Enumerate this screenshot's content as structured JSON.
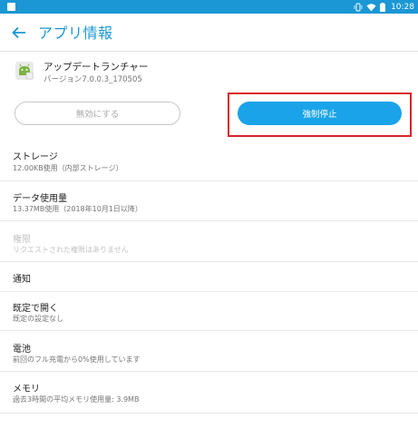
{
  "status_bar": {
    "time": "10:28",
    "icons": [
      "vibrate-icon",
      "wifi-icon",
      "battery-icon"
    ]
  },
  "app_bar": {
    "title": "アプリ情報",
    "back_icon": "arrow-left-icon"
  },
  "app": {
    "name": "アップデートランチャー",
    "version": "バージョン7.0.0.3_170505",
    "icon": "android-app-icon"
  },
  "buttons": {
    "disable": "無効にする",
    "force_stop": "強制停止"
  },
  "settings": [
    {
      "title": "ストレージ",
      "summary": "12.00KB使用（内部ストレージ）",
      "enabled": true
    },
    {
      "title": "データ使用量",
      "summary": "13.37MB使用（2018年10月1日以降）",
      "enabled": true
    },
    {
      "title": "権限",
      "summary": "リクエストされた権限はありません",
      "enabled": false
    },
    {
      "title": "通知",
      "summary": "",
      "enabled": true
    },
    {
      "title": "既定で開く",
      "summary": "既定の設定なし",
      "enabled": true
    },
    {
      "title": "電池",
      "summary": "前回のフル充電から0%使用しています",
      "enabled": true
    },
    {
      "title": "メモリ",
      "summary": "過去3時間の平均メモリ使用量: 3.9MB",
      "enabled": true
    }
  ],
  "colors": {
    "status_bar": "#1a97d4",
    "accent": "#1a97d4",
    "button": "#1aa3e8",
    "highlight": "#d9222a"
  }
}
